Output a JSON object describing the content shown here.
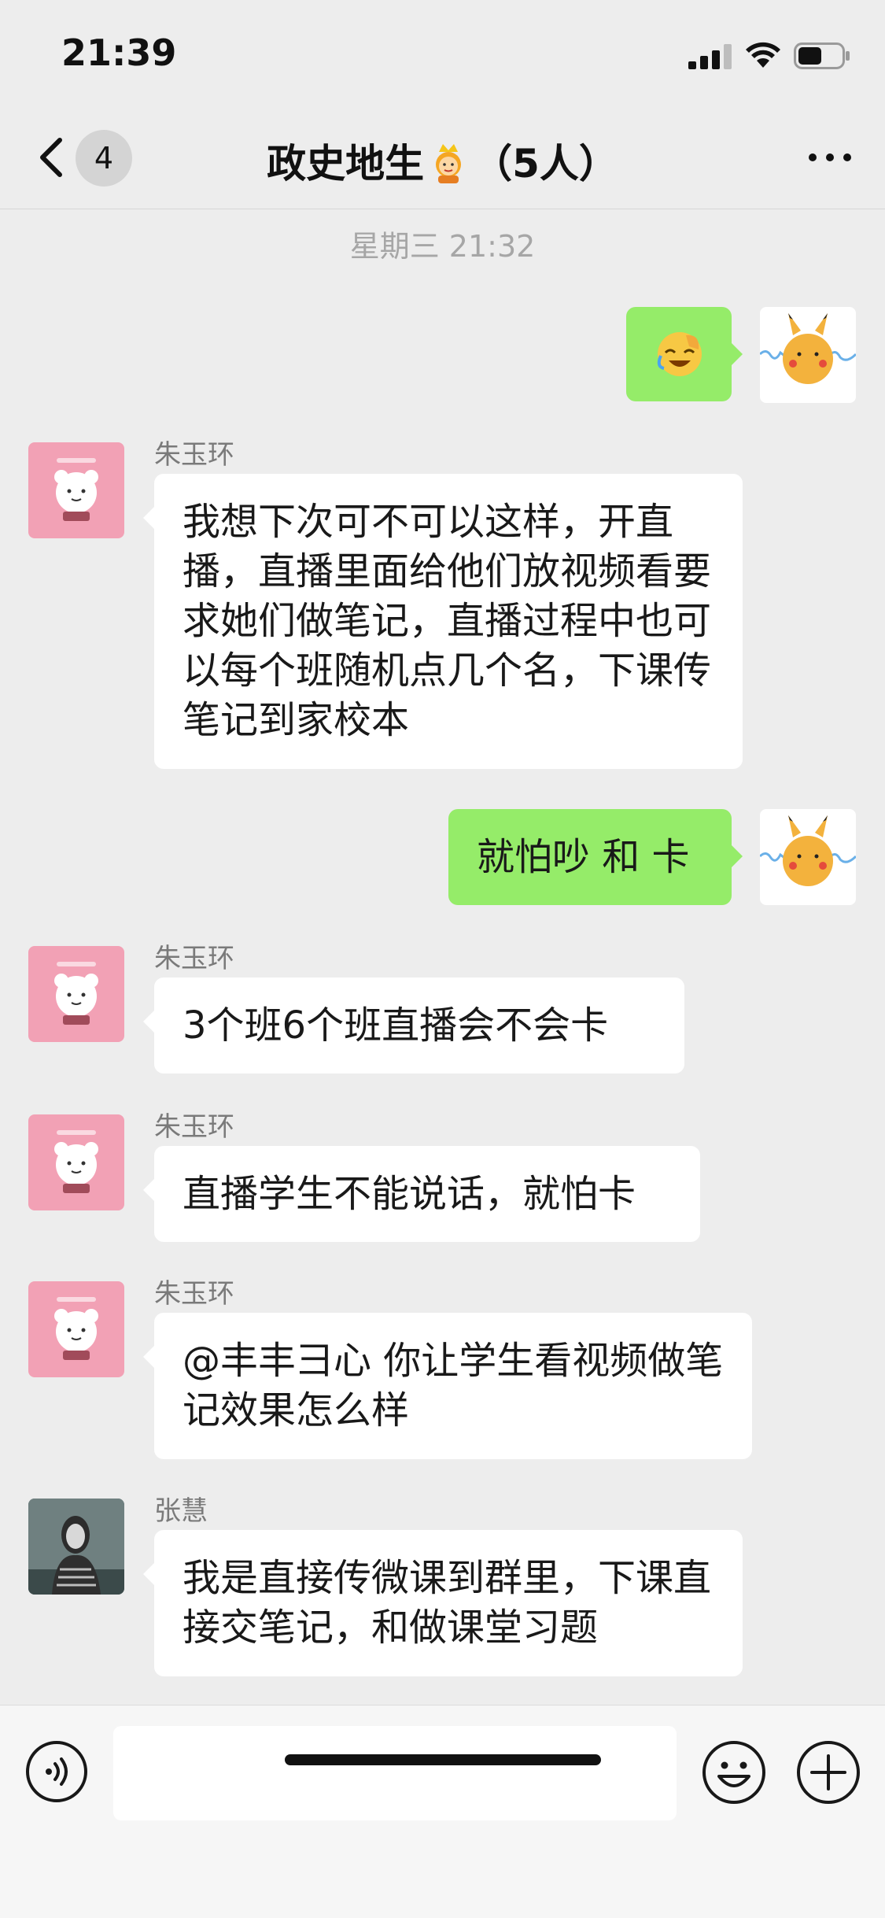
{
  "status_bar": {
    "time": "21:39",
    "battery_level": 0.55
  },
  "header": {
    "back_icon": "chevron-left-icon",
    "unread_count": "4",
    "title": "政史地生",
    "title_emoji": "princess-emoji",
    "member_count": "（5人）",
    "more_icon": "more-horizontal-icon"
  },
  "timestamp": "星期三 21:32",
  "messages": [
    {
      "side": "right",
      "type": "emoji",
      "emoji": "face-palm-laughing-emoji",
      "avatar": "pikachu-avatar"
    },
    {
      "side": "left",
      "sender": "朱玉环",
      "text": "我想下次可不可以这样，开直播，直播里面给他们放视频看要求她们做笔记，直播过程中也可以每个班随机点几个名，下课传笔记到家校本",
      "avatar": "bear-avatar"
    },
    {
      "side": "right",
      "text": "就怕吵 和 卡",
      "avatar": "pikachu-avatar"
    },
    {
      "side": "left",
      "sender": "朱玉环",
      "text": "3个班6个班直播会不会卡",
      "avatar": "bear-avatar"
    },
    {
      "side": "left",
      "sender": "朱玉环",
      "text": "直播学生不能说话，就怕卡",
      "avatar": "bear-avatar"
    },
    {
      "side": "left",
      "sender": "朱玉环",
      "text": "@丰丰彐心 你让学生看视频做笔记效果怎么样",
      "avatar": "bear-avatar"
    },
    {
      "side": "left",
      "sender": "张慧",
      "text": "我是直接传微课到群里，下课直接交笔记，和做课堂习题",
      "avatar": "photo-avatar"
    }
  ],
  "input_bar": {
    "voice_icon": "voice-icon",
    "input_value": "",
    "emoji_icon": "smiley-icon",
    "plus_icon": "plus-circle-icon"
  },
  "colors": {
    "background": "#ededed",
    "self_bubble": "#95ec69",
    "other_bubble": "#ffffff"
  }
}
